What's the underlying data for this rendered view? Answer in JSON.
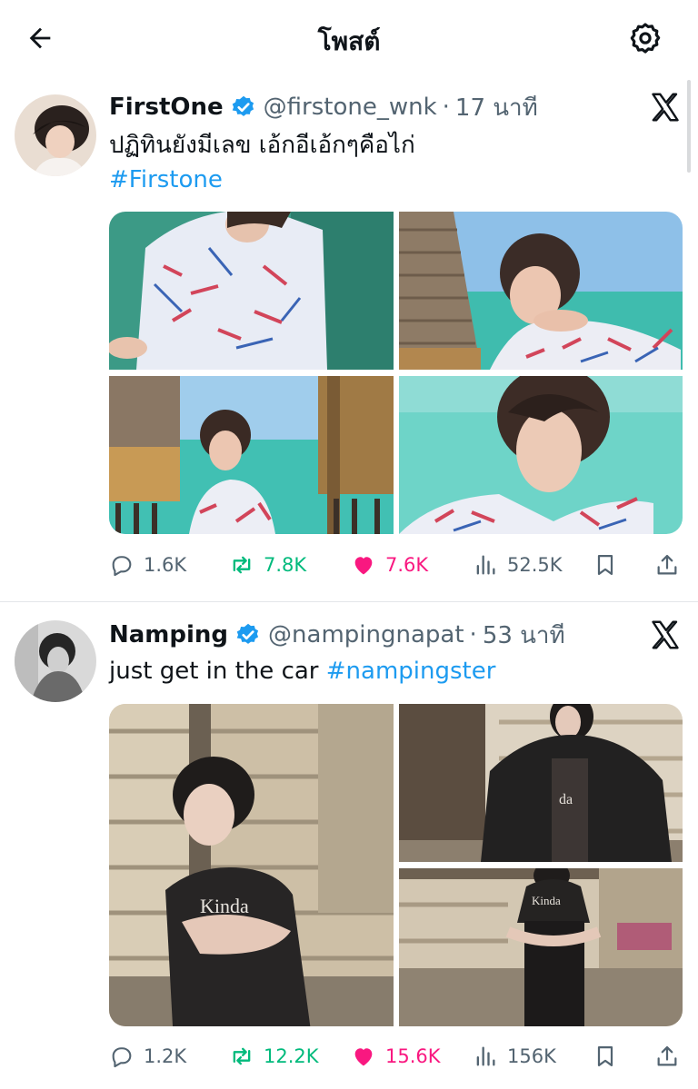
{
  "header": {
    "title": "โพสต์",
    "back_icon": "arrow-left-icon",
    "settings_icon": "gear-icon"
  },
  "posts": [
    {
      "display_name": "FirstOne",
      "handle": "@firstone_wnk",
      "separator": "·",
      "time": "17 นาที",
      "verified": true,
      "text": "ปฏิทินยังมีเลข เอ้กอีเอ้กๆคือไก่",
      "hashtag": "#Firstone",
      "media_count": 4,
      "stats": {
        "replies": "1.6K",
        "reposts": "7.8K",
        "likes": "7.6K",
        "views": "52.5K"
      }
    },
    {
      "display_name": "Namping",
      "handle": "@nampingnapat",
      "separator": "·",
      "time": "53 นาที",
      "verified": true,
      "text": "just get in the car ",
      "hashtag": "#nampingster",
      "media_count": 3,
      "stats": {
        "replies": "1.2K",
        "reposts": "12.2K",
        "likes": "15.6K",
        "views": "156K"
      }
    }
  ],
  "colors": {
    "link": "#1d9bf0",
    "repost": "#00ba7c",
    "like": "#f91880",
    "secondary_text": "#536471",
    "verified": "#1d9bf0"
  },
  "icons": [
    "reply-icon",
    "repost-icon",
    "heart-icon",
    "views-icon",
    "bookmark-icon",
    "share-icon",
    "x-logo-icon",
    "verified-badge-icon"
  ]
}
